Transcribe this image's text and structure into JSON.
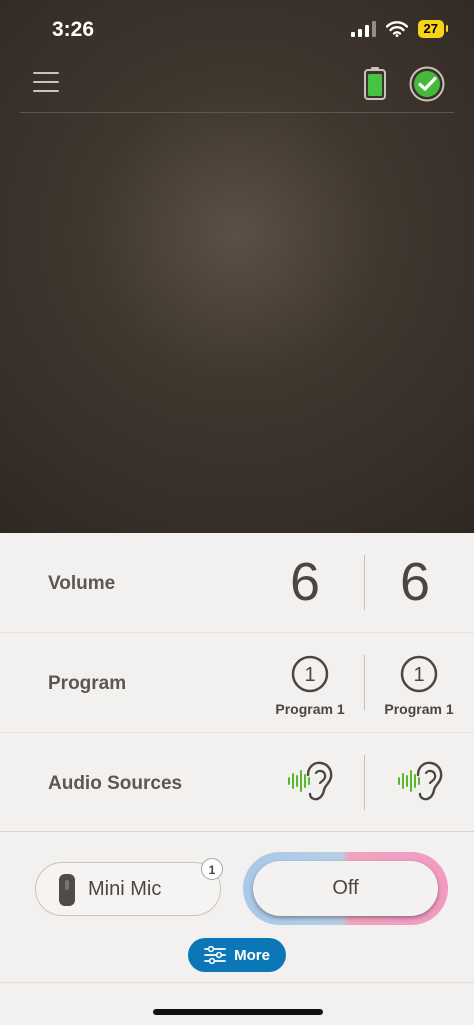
{
  "status_bar": {
    "time": "3:26",
    "battery": "27"
  },
  "panel": {
    "volume": {
      "label": "Volume",
      "left": "6",
      "right": "6"
    },
    "program": {
      "label": "Program",
      "left_number": "1",
      "right_number": "1",
      "left_name": "Program 1",
      "right_name": "Program 1"
    },
    "audio_sources": {
      "label": "Audio Sources"
    }
  },
  "bottom": {
    "mini_mic": {
      "label": "Mini Mic",
      "badge": "1"
    },
    "toggle": {
      "label": "Off"
    },
    "more": {
      "label": "More"
    }
  },
  "colors": {
    "accent_blue": "#0b77b6",
    "battery_green": "#47c341",
    "audio_green": "#5ab82e"
  }
}
